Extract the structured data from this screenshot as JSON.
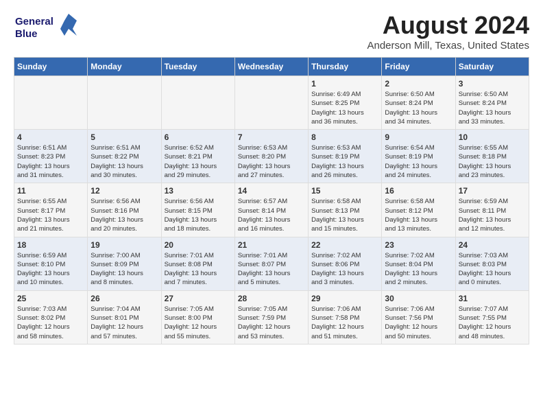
{
  "header": {
    "logo_line1": "General",
    "logo_line2": "Blue",
    "main_title": "August 2024",
    "sub_title": "Anderson Mill, Texas, United States"
  },
  "weekdays": [
    "Sunday",
    "Monday",
    "Tuesday",
    "Wednesday",
    "Thursday",
    "Friday",
    "Saturday"
  ],
  "weeks": [
    [
      {
        "day": "",
        "content": ""
      },
      {
        "day": "",
        "content": ""
      },
      {
        "day": "",
        "content": ""
      },
      {
        "day": "",
        "content": ""
      },
      {
        "day": "1",
        "content": "Sunrise: 6:49 AM\nSunset: 8:25 PM\nDaylight: 13 hours\nand 36 minutes."
      },
      {
        "day": "2",
        "content": "Sunrise: 6:50 AM\nSunset: 8:24 PM\nDaylight: 13 hours\nand 34 minutes."
      },
      {
        "day": "3",
        "content": "Sunrise: 6:50 AM\nSunset: 8:24 PM\nDaylight: 13 hours\nand 33 minutes."
      }
    ],
    [
      {
        "day": "4",
        "content": "Sunrise: 6:51 AM\nSunset: 8:23 PM\nDaylight: 13 hours\nand 31 minutes."
      },
      {
        "day": "5",
        "content": "Sunrise: 6:51 AM\nSunset: 8:22 PM\nDaylight: 13 hours\nand 30 minutes."
      },
      {
        "day": "6",
        "content": "Sunrise: 6:52 AM\nSunset: 8:21 PM\nDaylight: 13 hours\nand 29 minutes."
      },
      {
        "day": "7",
        "content": "Sunrise: 6:53 AM\nSunset: 8:20 PM\nDaylight: 13 hours\nand 27 minutes."
      },
      {
        "day": "8",
        "content": "Sunrise: 6:53 AM\nSunset: 8:19 PM\nDaylight: 13 hours\nand 26 minutes."
      },
      {
        "day": "9",
        "content": "Sunrise: 6:54 AM\nSunset: 8:19 PM\nDaylight: 13 hours\nand 24 minutes."
      },
      {
        "day": "10",
        "content": "Sunrise: 6:55 AM\nSunset: 8:18 PM\nDaylight: 13 hours\nand 23 minutes."
      }
    ],
    [
      {
        "day": "11",
        "content": "Sunrise: 6:55 AM\nSunset: 8:17 PM\nDaylight: 13 hours\nand 21 minutes."
      },
      {
        "day": "12",
        "content": "Sunrise: 6:56 AM\nSunset: 8:16 PM\nDaylight: 13 hours\nand 20 minutes."
      },
      {
        "day": "13",
        "content": "Sunrise: 6:56 AM\nSunset: 8:15 PM\nDaylight: 13 hours\nand 18 minutes."
      },
      {
        "day": "14",
        "content": "Sunrise: 6:57 AM\nSunset: 8:14 PM\nDaylight: 13 hours\nand 16 minutes."
      },
      {
        "day": "15",
        "content": "Sunrise: 6:58 AM\nSunset: 8:13 PM\nDaylight: 13 hours\nand 15 minutes."
      },
      {
        "day": "16",
        "content": "Sunrise: 6:58 AM\nSunset: 8:12 PM\nDaylight: 13 hours\nand 13 minutes."
      },
      {
        "day": "17",
        "content": "Sunrise: 6:59 AM\nSunset: 8:11 PM\nDaylight: 13 hours\nand 12 minutes."
      }
    ],
    [
      {
        "day": "18",
        "content": "Sunrise: 6:59 AM\nSunset: 8:10 PM\nDaylight: 13 hours\nand 10 minutes."
      },
      {
        "day": "19",
        "content": "Sunrise: 7:00 AM\nSunset: 8:09 PM\nDaylight: 13 hours\nand 8 minutes."
      },
      {
        "day": "20",
        "content": "Sunrise: 7:01 AM\nSunset: 8:08 PM\nDaylight: 13 hours\nand 7 minutes."
      },
      {
        "day": "21",
        "content": "Sunrise: 7:01 AM\nSunset: 8:07 PM\nDaylight: 13 hours\nand 5 minutes."
      },
      {
        "day": "22",
        "content": "Sunrise: 7:02 AM\nSunset: 8:06 PM\nDaylight: 13 hours\nand 3 minutes."
      },
      {
        "day": "23",
        "content": "Sunrise: 7:02 AM\nSunset: 8:04 PM\nDaylight: 13 hours\nand 2 minutes."
      },
      {
        "day": "24",
        "content": "Sunrise: 7:03 AM\nSunset: 8:03 PM\nDaylight: 13 hours\nand 0 minutes."
      }
    ],
    [
      {
        "day": "25",
        "content": "Sunrise: 7:03 AM\nSunset: 8:02 PM\nDaylight: 12 hours\nand 58 minutes."
      },
      {
        "day": "26",
        "content": "Sunrise: 7:04 AM\nSunset: 8:01 PM\nDaylight: 12 hours\nand 57 minutes."
      },
      {
        "day": "27",
        "content": "Sunrise: 7:05 AM\nSunset: 8:00 PM\nDaylight: 12 hours\nand 55 minutes."
      },
      {
        "day": "28",
        "content": "Sunrise: 7:05 AM\nSunset: 7:59 PM\nDaylight: 12 hours\nand 53 minutes."
      },
      {
        "day": "29",
        "content": "Sunrise: 7:06 AM\nSunset: 7:58 PM\nDaylight: 12 hours\nand 51 minutes."
      },
      {
        "day": "30",
        "content": "Sunrise: 7:06 AM\nSunset: 7:56 PM\nDaylight: 12 hours\nand 50 minutes."
      },
      {
        "day": "31",
        "content": "Sunrise: 7:07 AM\nSunset: 7:55 PM\nDaylight: 12 hours\nand 48 minutes."
      }
    ]
  ]
}
